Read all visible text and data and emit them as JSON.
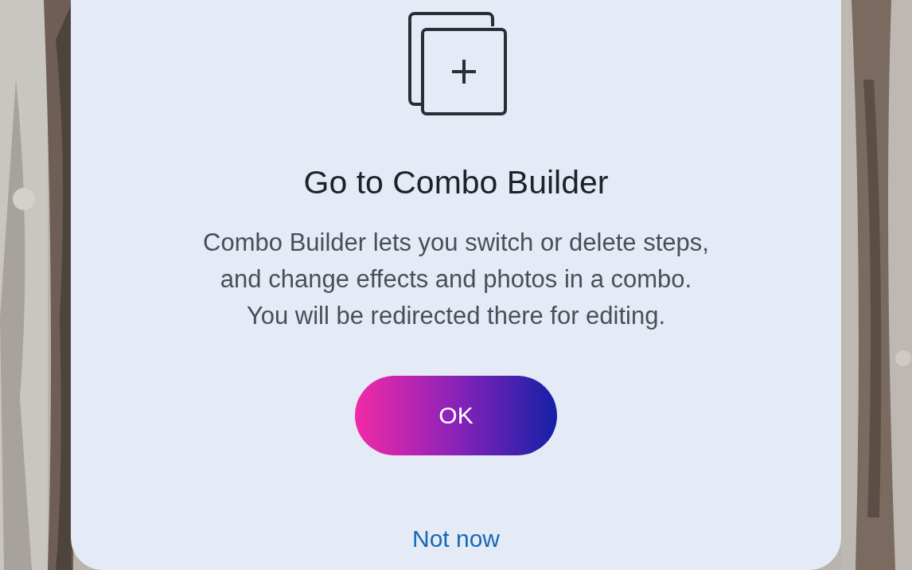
{
  "dialog": {
    "title": "Go to Combo Builder",
    "message": [
      "Combo Builder lets you switch or delete steps,",
      "and change effects and photos in a combo.",
      "You will be redirected there for editing."
    ],
    "primary_button": "OK",
    "secondary_link": "Not now"
  }
}
